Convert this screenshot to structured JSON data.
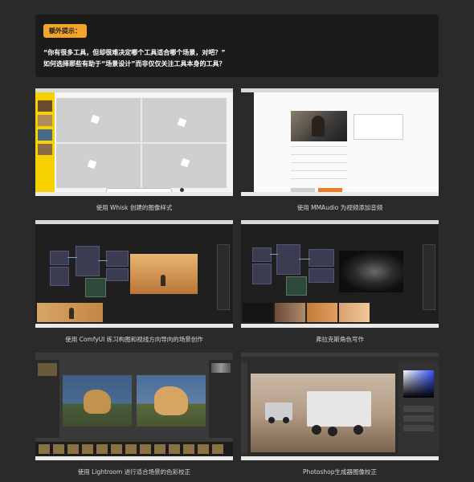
{
  "tip": {
    "badge": "额外提示：",
    "line1": "“你有很多工具，但却很难决定哪个工具适合哪个场景，对吧？”",
    "line2": "如何选择那些有助于“场景设计”而非仅仅关注工具本身的工具？"
  },
  "tiles": [
    {
      "caption": "使用 Whisk 创建的图像样式"
    },
    {
      "caption": "使用 MMAudio 为视频添加音频"
    },
    {
      "caption": "使用 ComfyUI 练习构图和视线方向导向的场景创作"
    },
    {
      "caption": "弗拉克斯角色写作"
    },
    {
      "caption": "使用 Lightroom 进行适合场景的色彩校正"
    },
    {
      "caption": "Photoshop生成器图像校正"
    }
  ],
  "colors": {
    "background": "#2a2a2a",
    "tip_box": "#1b1b1b",
    "accent": "#f2a52a"
  }
}
